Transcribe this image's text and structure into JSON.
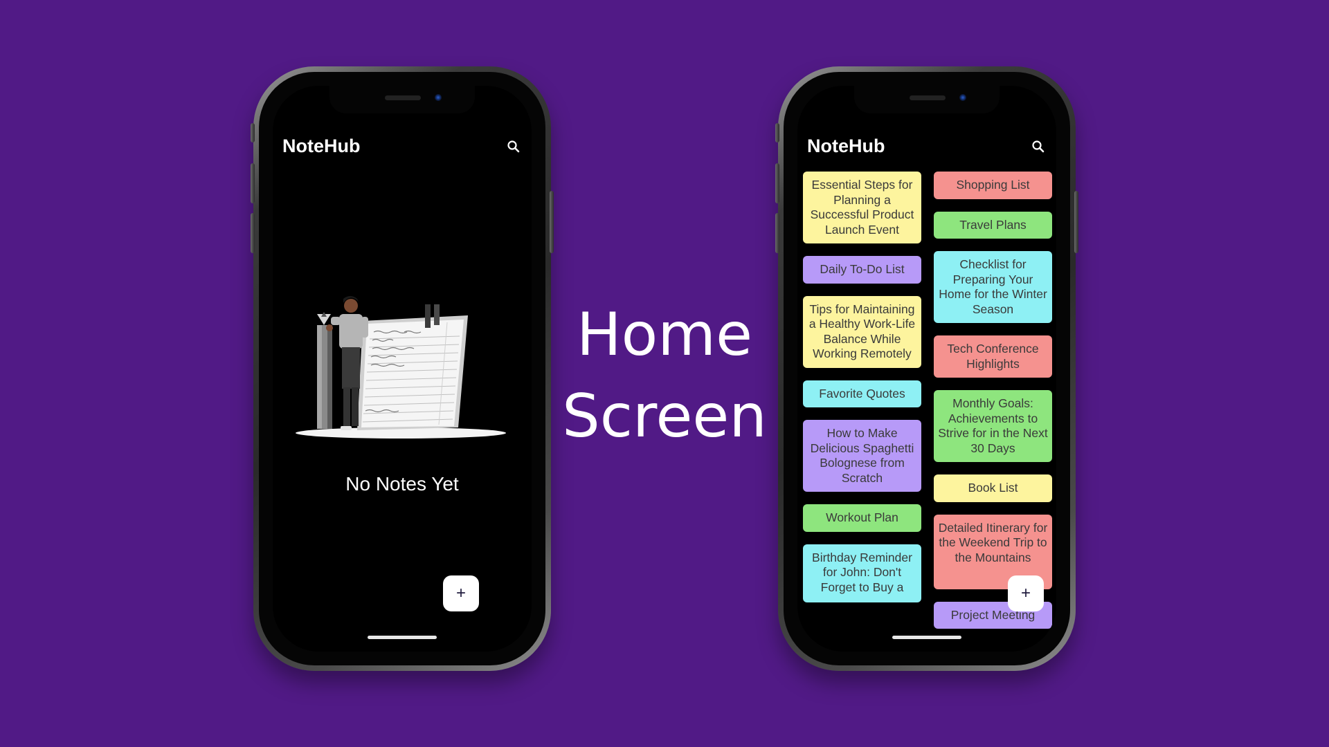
{
  "caption": {
    "line1": "Home",
    "line2": "Screen"
  },
  "colors": {
    "background": "#511a86",
    "note_yellow": "#fdf49e",
    "note_purple": "#b79af8",
    "note_red": "#f5928f",
    "note_green": "#8ee57e",
    "note_cyan": "#8ef0f4"
  },
  "phone_empty": {
    "app_title": "NoteHub",
    "search_icon": "search-icon",
    "empty_text": "No Notes Yet",
    "fab_label": "+"
  },
  "phone_list": {
    "app_title": "NoteHub",
    "search_icon": "search-icon",
    "fab_label": "+",
    "left_notes": [
      {
        "title": "Essential Steps for Planning a Successful Product Launch Event",
        "color": "#fdf49e"
      },
      {
        "title": "Daily To-Do List",
        "color": "#b79af8"
      },
      {
        "title": "Tips for Maintaining a Healthy Work-Life Balance While Working Remotely",
        "color": "#fdf49e"
      },
      {
        "title": "Favorite Quotes",
        "color": "#8ef0f4"
      },
      {
        "title": "How to Make Delicious Spaghetti Bolognese from Scratch",
        "color": "#b79af8"
      },
      {
        "title": "Workout Plan",
        "color": "#8ee57e"
      },
      {
        "title": "Birthday Reminder for John: Don't Forget to Buy a",
        "color": "#8ef0f4"
      }
    ],
    "right_notes": [
      {
        "title": "Shopping List",
        "color": "#f5928f"
      },
      {
        "title": "Travel Plans",
        "color": "#8ee57e"
      },
      {
        "title": "Checklist for Preparing Your Home for the Winter Season",
        "color": "#8ef0f4"
      },
      {
        "title": "Tech Conference Highlights",
        "color": "#f5928f"
      },
      {
        "title": "Monthly Goals: Achievements to Strive for in the Next 30 Days",
        "color": "#8ee57e"
      },
      {
        "title": "Book List",
        "color": "#fdf49e"
      },
      {
        "title": "Detailed Itinerary for the Weekend Trip to the Mountains",
        "color": "#f5928f"
      },
      {
        "title": "Project Meeting",
        "color": "#b79af8"
      }
    ]
  }
}
